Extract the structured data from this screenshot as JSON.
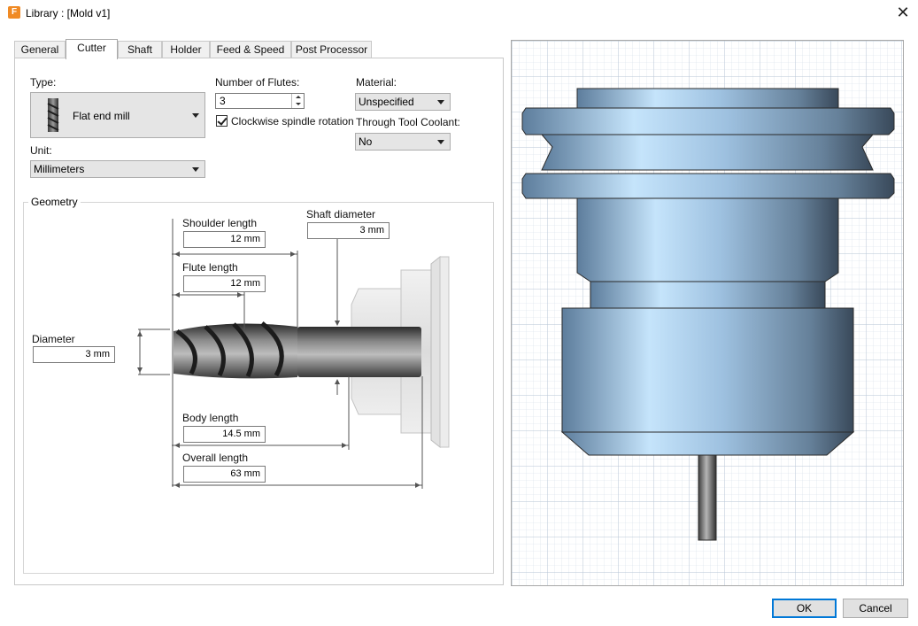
{
  "window": {
    "title": "Library : [Mold v1]",
    "app_icon_letter": "F",
    "close_glyph": "✕"
  },
  "tabs": [
    {
      "label": "General",
      "active": false
    },
    {
      "label": "Cutter",
      "active": true
    },
    {
      "label": "Shaft",
      "active": false
    },
    {
      "label": "Holder",
      "active": false
    },
    {
      "label": "Feed & Speed",
      "active": false
    },
    {
      "label": "Post Processor",
      "active": false
    }
  ],
  "cutter": {
    "type_label": "Type:",
    "type_value": "Flat end mill",
    "unit_label": "Unit:",
    "unit_value": "Millimeters",
    "flutes_label": "Number of Flutes:",
    "flutes_value": "3",
    "clockwise_label": "Clockwise spindle rotation",
    "clockwise_checked": true,
    "material_label": "Material:",
    "material_value": "Unspecified",
    "coolant_label": "Through Tool Coolant:",
    "coolant_value": "No"
  },
  "geometry": {
    "title": "Geometry",
    "shoulder_length_label": "Shoulder length",
    "shoulder_length_value": "12 mm",
    "flute_length_label": "Flute length",
    "flute_length_value": "12 mm",
    "shaft_diameter_label": "Shaft diameter",
    "shaft_diameter_value": "3 mm",
    "diameter_label": "Diameter",
    "diameter_value": "3 mm",
    "body_length_label": "Body length",
    "body_length_value": "14.5 mm",
    "overall_length_label": "Overall length",
    "overall_length_value": "63 mm"
  },
  "preview": {
    "holder_color": "#8fb3d9",
    "grid_color": "#cfdbe8"
  },
  "buttons": {
    "ok_label": "OK",
    "cancel_label": "Cancel"
  }
}
